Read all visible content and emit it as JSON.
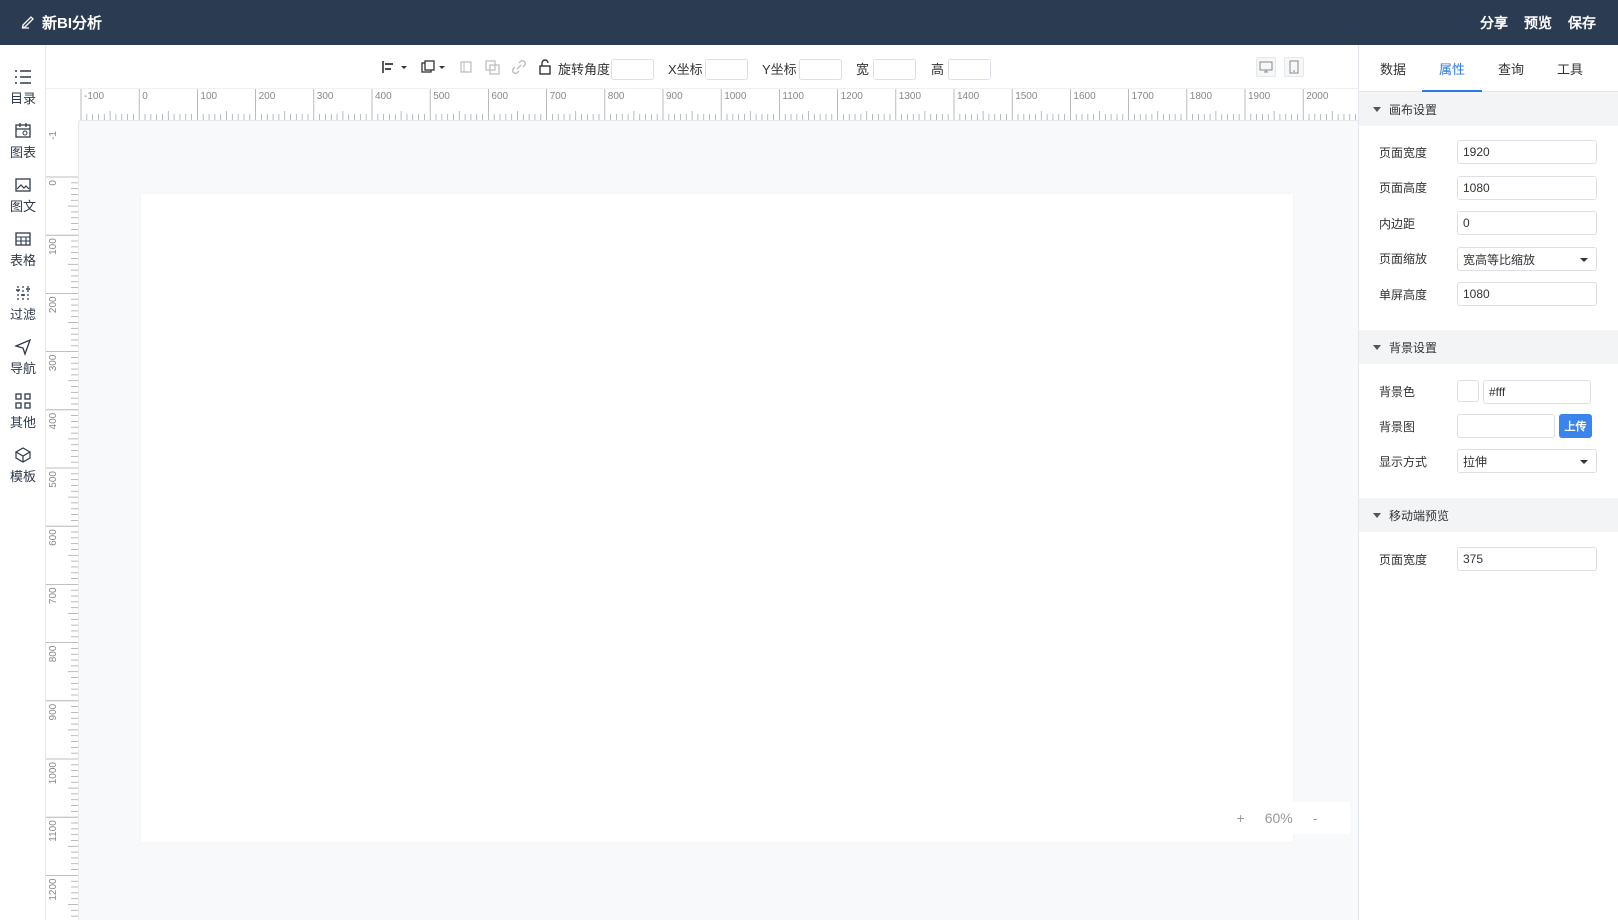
{
  "header": {
    "title": "新BI分析",
    "actions": [
      "分享",
      "预览",
      "保存"
    ]
  },
  "sidebar": {
    "items": [
      {
        "label": "目录",
        "icon": "list-icon"
      },
      {
        "label": "图表",
        "icon": "chart-calendar-icon"
      },
      {
        "label": "图文",
        "icon": "image-text-icon"
      },
      {
        "label": "表格",
        "icon": "table-icon"
      },
      {
        "label": "过滤",
        "icon": "filter-icon"
      },
      {
        "label": "导航",
        "icon": "navigation-icon"
      },
      {
        "label": "其他",
        "icon": "grid-icon"
      },
      {
        "label": "模板",
        "icon": "template-icon"
      }
    ]
  },
  "toolbar": {
    "rotate_label": "旋转角度",
    "x_label": "X坐标",
    "y_label": "Y坐标",
    "w_label": "宽",
    "h_label": "高"
  },
  "ruler": {
    "top_ticks": [
      "-100",
      "0",
      "100",
      "200",
      "300",
      "400",
      "500",
      "600",
      "700",
      "800",
      "900",
      "1000",
      "1100",
      "1200",
      "1300",
      "1400",
      "1500",
      "1600",
      "1700",
      "1800",
      "1900",
      "2000"
    ],
    "left_ticks": [
      "-1",
      "0",
      "100",
      "200",
      "300",
      "400",
      "500",
      "600",
      "700",
      "800",
      "900",
      "1000",
      "1100",
      "1200"
    ]
  },
  "zoom": {
    "plus": "+",
    "value": "60%",
    "minus": "-"
  },
  "panel": {
    "tabs": [
      "数据",
      "属性",
      "查询",
      "工具"
    ],
    "active_tab": "属性",
    "canvas_section": {
      "title": "画布设置",
      "page_width_label": "页面宽度",
      "page_width": "1920",
      "page_height_label": "页面高度",
      "page_height": "1080",
      "padding_label": "内边距",
      "padding": "0",
      "zoom_label": "页面缩放",
      "zoom_mode": "宽高等比缩放",
      "screen_height_label": "单屏高度",
      "screen_height": "1080"
    },
    "bg_section": {
      "title": "背景设置",
      "color_label": "背景色",
      "color_value": "#fff",
      "image_label": "背景图",
      "upload_label": "上传",
      "display_label": "显示方式",
      "display_mode": "拉伸"
    },
    "mobile_section": {
      "title": "移动端预览",
      "page_width_label": "页面宽度",
      "page_width": "375"
    }
  },
  "colors": {
    "header_bg": "#2b3c52",
    "accent": "#2c7be5",
    "upload_btn": "#3a84ee"
  }
}
